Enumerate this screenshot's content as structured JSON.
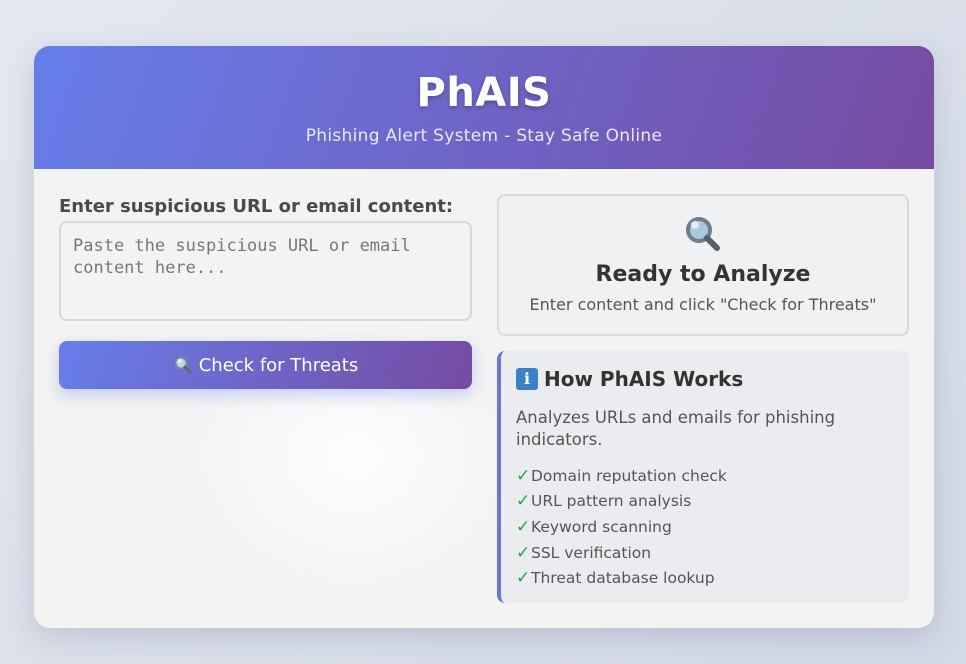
{
  "header": {
    "title": "PhAIS",
    "subtitle": "Phishing Alert System - Stay Safe Online"
  },
  "form": {
    "label": "Enter suspicious URL or email content:",
    "placeholder": "Paste the suspicious URL or email content here...",
    "value": "",
    "button_label": "Check for Threats",
    "button_icon": "magnifier-icon"
  },
  "status": {
    "icon": "magnifier-icon",
    "title": "Ready to Analyze",
    "text": "Enter content and click \"Check for Threats\""
  },
  "info": {
    "icon": "info-icon",
    "icon_glyph": "i",
    "title": "How PhAIS Works",
    "description": "Analyzes URLs and emails for phishing indicators.",
    "check_glyph": "✓",
    "features": [
      "Domain reputation check",
      "URL pattern analysis",
      "Keyword scanning",
      "SSL verification",
      "Threat database lookup"
    ]
  },
  "colors": {
    "gradient_start": "#667eea",
    "gradient_end": "#764ba2",
    "check_green": "#2da14a",
    "info_blue": "#3b82c4"
  }
}
